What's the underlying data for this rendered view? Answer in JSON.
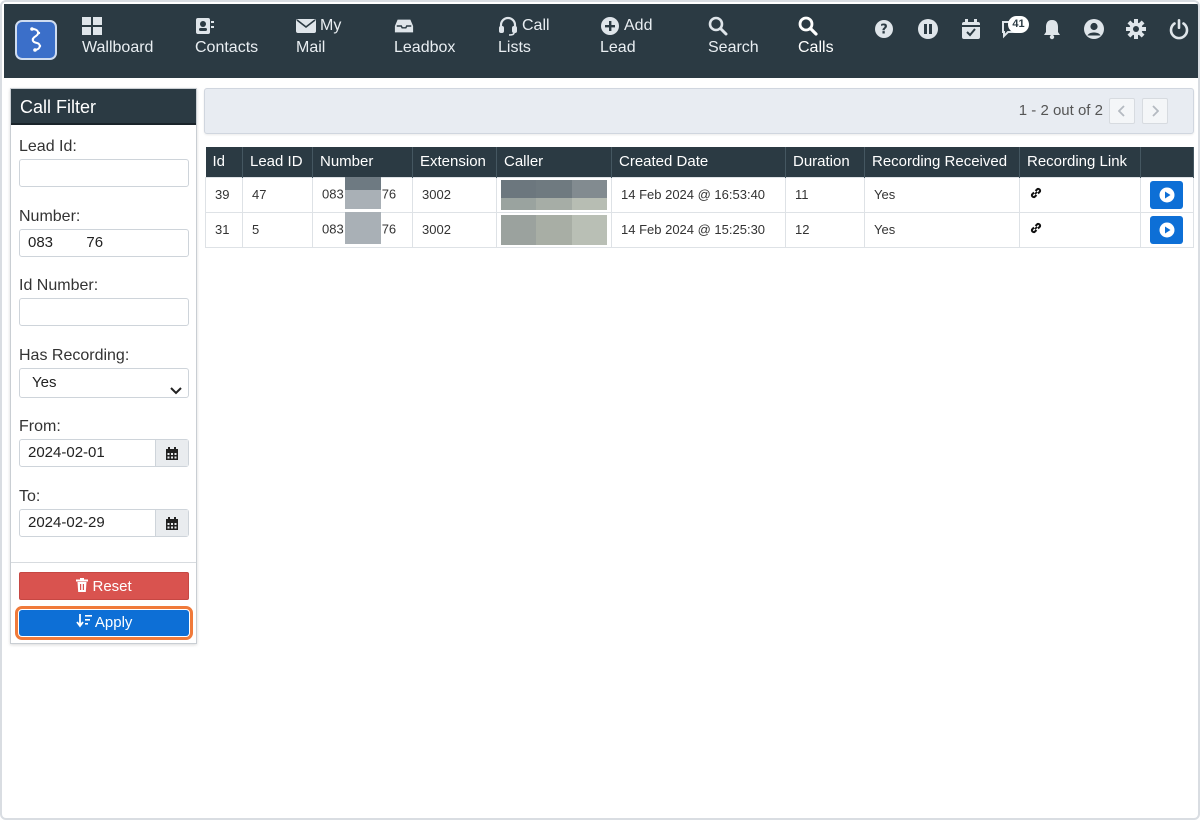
{
  "nav": {
    "items": [
      {
        "line1": "",
        "line2": "Wallboard",
        "icon": "dashboard-icon"
      },
      {
        "line1": "",
        "line2": "Contacts",
        "icon": "contacts-icon"
      },
      {
        "line1": "My",
        "line2": "Mail",
        "icon": "mail-icon"
      },
      {
        "line1": "",
        "line2": "Leadbox",
        "icon": "inbox-icon"
      },
      {
        "line1": "Call",
        "line2": "Lists",
        "icon": "headset-icon"
      },
      {
        "line1": "Add",
        "line2": "Lead",
        "icon": "plus-circle-icon"
      },
      {
        "line1": "",
        "line2": "Search",
        "icon": "search-icon"
      },
      {
        "line1": "",
        "line2": "Calls",
        "icon": "search-icon"
      }
    ],
    "active": "Calls",
    "right_icons": [
      "help-icon",
      "pause-icon",
      "calendar-check-icon",
      "chat-icon",
      "bell-icon",
      "user-icon",
      "gear-icon",
      "power-icon"
    ],
    "chat_badge": "41"
  },
  "sidebar": {
    "title": "Call Filter",
    "lead_id_label": "Lead Id:",
    "lead_id_value": "",
    "number_label": "Number:",
    "number_value": "083        76",
    "id_number_label": "Id Number:",
    "id_number_value": "",
    "has_recording_label": "Has Recording:",
    "has_recording_value": "Yes",
    "from_label": "From:",
    "from_value": "2024-02-01",
    "to_label": "To:",
    "to_value": "2024-02-29",
    "reset_label": "Reset",
    "apply_label": "Apply"
  },
  "pager": {
    "text": "1 - 2 out of 2"
  },
  "table": {
    "headers": [
      "Id",
      "Lead ID",
      "Number",
      "Extension",
      "Caller",
      "Created Date",
      "Duration",
      "Recording Received",
      "Recording Link",
      ""
    ],
    "rows": [
      {
        "id": "39",
        "lead_id": "47",
        "num_prefix": "083",
        "num_suffix": "76",
        "extension": "3002",
        "created": "14 Feb 2024 @ 16:53:40",
        "duration": "11",
        "received": "Yes"
      },
      {
        "id": "31",
        "lead_id": "5",
        "num_prefix": "083",
        "num_suffix": "76",
        "extension": "3002",
        "created": "14 Feb 2024 @ 15:25:30",
        "duration": "12",
        "received": "Yes"
      }
    ]
  },
  "colors": {
    "nav_bg": "#2b3a43",
    "primary": "#0d6fd6",
    "danger": "#d9534f",
    "highlight": "#f07a3a"
  }
}
